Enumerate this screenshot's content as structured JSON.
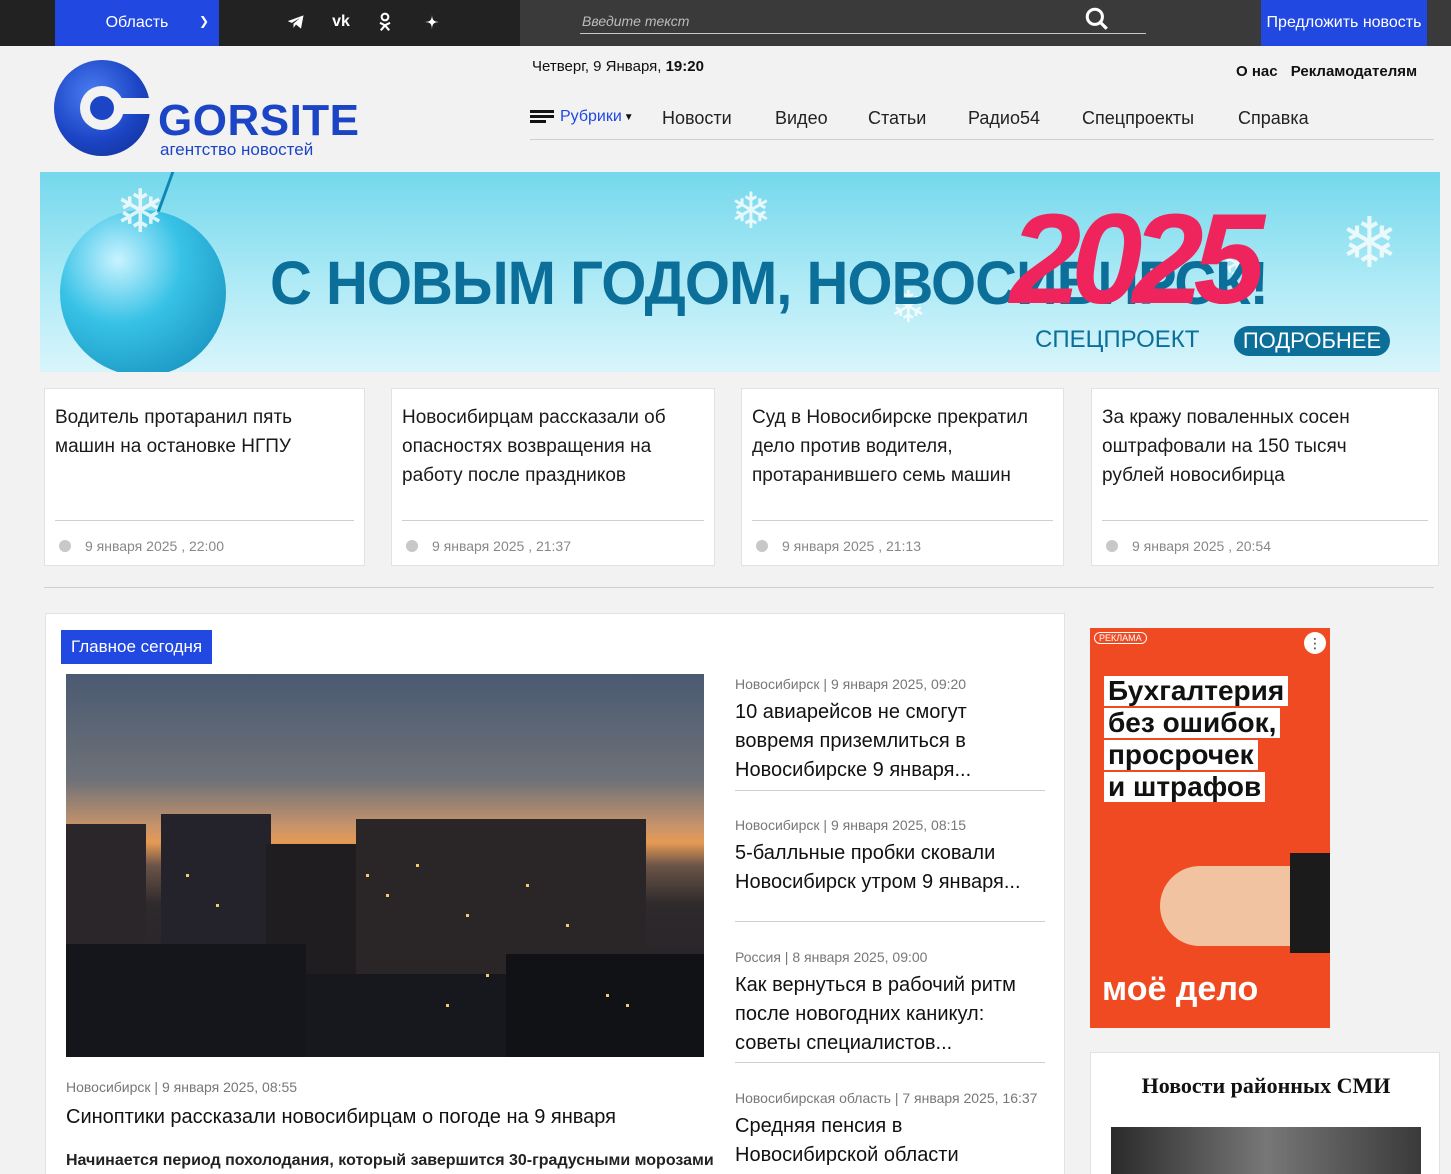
{
  "topbar": {
    "region_label": "Область",
    "social_icons": [
      "telegram-icon",
      "vk-icon",
      "odnoklassniki-icon",
      "zen-icon"
    ],
    "search_placeholder": "Введите текст",
    "suggest_label": "Предложить новость"
  },
  "header": {
    "logo_brand": "GORSITE",
    "logo_tagline": "агентство новостей",
    "date_text": "Четверг, 9 Января,",
    "time_text": "19:20",
    "links": [
      "О нас",
      "Рекламодателям"
    ],
    "nav_rubrics": "Рубрики",
    "nav_items": [
      "Новости",
      "Видео",
      "Статьи",
      "Радио54",
      "Спецпроекты",
      "Справка"
    ]
  },
  "banner": {
    "title": "С НОВЫМ ГОДОМ, НОВОСИБИРСК!",
    "year": "2025",
    "special": "СПЕЦПРОЕКТ",
    "more": "ПОДРОБНЕЕ"
  },
  "cards": [
    {
      "title": "Водитель протаранил пять машин на остановке НГПУ",
      "date": "9 января 2025 , 22:00"
    },
    {
      "title": "Новосибирцам рассказали об опасностях возвращения на работу после праздников",
      "date": "9 января 2025 , 21:37"
    },
    {
      "title": "Суд в Новосибирске прекратил дело против водителя, протаранившего семь машин",
      "date": "9 января 2025 , 21:13"
    },
    {
      "title": "За кражу поваленных сосен оштрафовали на 150 тысяч рублей новосибирца",
      "date": "9 января 2025 , 20:54"
    }
  ],
  "main": {
    "badge": "Главное сегодня",
    "lead": {
      "meta": "Новосибирск | 9 января 2025, 08:55",
      "title": "Синоптики рассказали новосибирцам о погоде на 9 января",
      "text": "Начинается период похолодания, который завершится 30-градусными морозами"
    },
    "side": [
      {
        "meta": "Новосибирск | 9 января 2025, 09:20",
        "title": "10 авиарейсов не смогут вовремя приземлиться в Новосибирске 9 января..."
      },
      {
        "meta": "Новосибирск | 9 января 2025, 08:15",
        "title": "5-балльные пробки сковали Новосибирск утром 9 января..."
      },
      {
        "meta": "Россия | 8 января 2025, 09:00",
        "title": "Как вернуться в рабочий ритм после новогодних каникул: советы специалистов..."
      },
      {
        "meta": "Новосибирская область | 7 января 2025, 16:37",
        "title": "Средняя пенсия в Новосибирской области"
      }
    ]
  },
  "ad": {
    "label": "РЕКЛАМА",
    "lines": [
      "Бухгалтерия",
      "без ошибок,",
      "просрочек",
      "и штрафов"
    ],
    "brand": "моё дело"
  },
  "district": {
    "heading": "Новости районных СМИ"
  }
}
